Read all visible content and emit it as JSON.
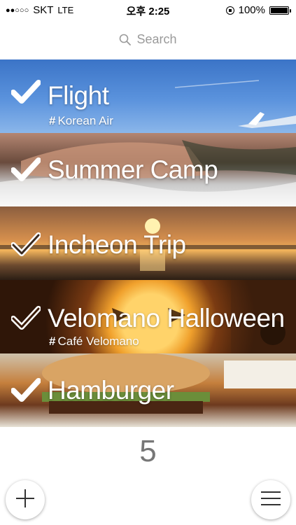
{
  "status_bar": {
    "carrier": "SKT",
    "network": "LTE",
    "time": "오후 2:25",
    "battery": "100%",
    "signal_dots_filled": 2,
    "signal_dots_total": 5
  },
  "search": {
    "placeholder": "Search",
    "icon": "search-icon"
  },
  "items": [
    {
      "title": "Flight",
      "tag": "Korean Air",
      "check_style": "filled"
    },
    {
      "title": "Summer Camp",
      "tag": "",
      "check_style": "filled"
    },
    {
      "title": "Incheon Trip",
      "tag": "",
      "check_style": "outline"
    },
    {
      "title": "Velomano Halloween",
      "tag": "Café Velomano",
      "check_style": "outline"
    },
    {
      "title": "Hamburger",
      "tag": "",
      "check_style": "filled"
    }
  ],
  "tag_prefix": "#",
  "count": "5",
  "actions": {
    "add_icon": "plus-icon",
    "menu_icon": "hamburger-menu-icon"
  }
}
